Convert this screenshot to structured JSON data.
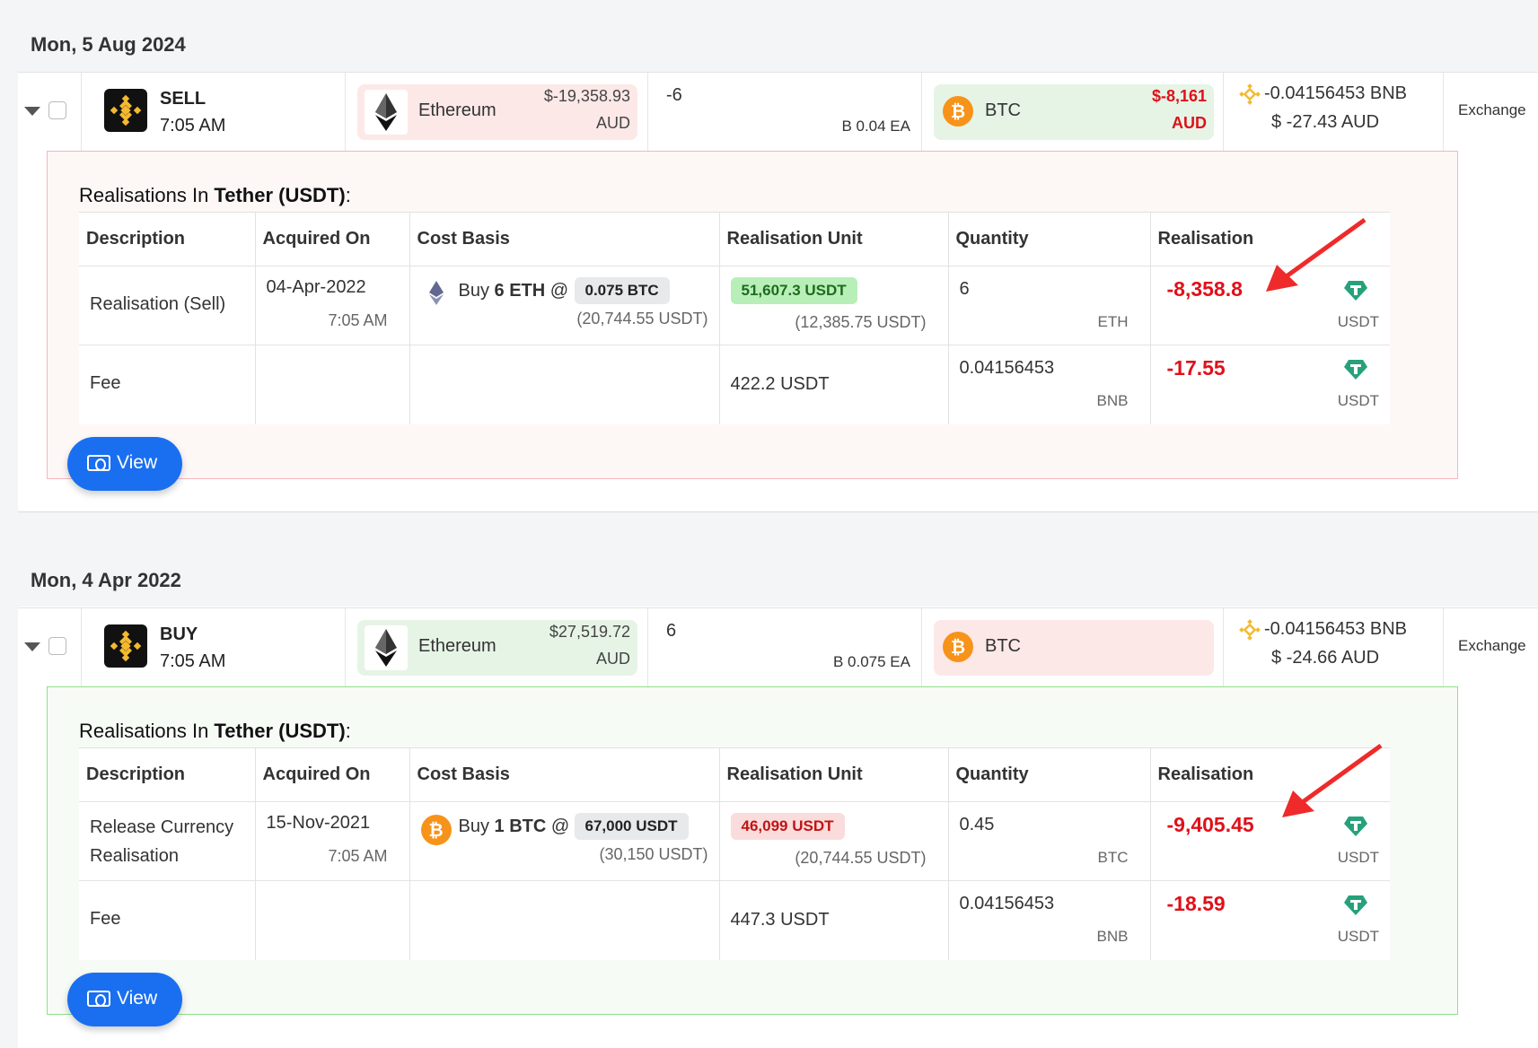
{
  "groups": [
    {
      "date": "Mon, 5 Aug 2024",
      "tx": {
        "side": "SELL",
        "time": "7:05 AM",
        "asset": {
          "name": "Ethereum",
          "amount": "$-19,358.93",
          "currency": "AUD"
        },
        "quantity": "-6",
        "price": "B 0.04 EA",
        "counter": {
          "name": "BTC",
          "amount": "$-8,161",
          "currency": "AUD"
        },
        "fee": {
          "amount": "-0.04156453 BNB",
          "value": "$ -27.43 AUD"
        },
        "type": "Exchange"
      },
      "panel": {
        "title_prefix": "Realisations In ",
        "title_bold": "Tether (USDT)",
        "title_suffix": ":",
        "rows": [
          {
            "description": "Realisation (Sell)",
            "acquired_date": "04-Apr-2022",
            "acquired_time": "7:05 AM",
            "cost_prefix": "Buy ",
            "cost_bold": "6 ETH",
            "cost_at": " @",
            "cost_badge": "0.075 BTC",
            "cost_sub": "(20,744.55 USDT)",
            "unit_badge": "51,607.3 USDT",
            "unit_sub": "(12,385.75 USDT)",
            "quantity": "6",
            "quantity_unit": "ETH",
            "realisation": "-8,358.8",
            "realisation_unit": "USDT"
          },
          {
            "description": "Fee",
            "unit_plain": "422.2 USDT",
            "quantity": "0.04156453",
            "quantity_unit": "BNB",
            "realisation": "-17.55",
            "realisation_unit": "USDT"
          }
        ],
        "view_label": "View"
      }
    },
    {
      "date": "Mon, 4 Apr 2022",
      "tx": {
        "side": "BUY",
        "time": "7:05 AM",
        "asset": {
          "name": "Ethereum",
          "amount": "$27,519.72",
          "currency": "AUD"
        },
        "quantity": "6",
        "price": "B 0.075 EA",
        "counter": {
          "name": "BTC"
        },
        "fee": {
          "amount": "-0.04156453 BNB",
          "value": "$ -24.66 AUD"
        },
        "type": "Exchange"
      },
      "panel": {
        "title_prefix": "Realisations In ",
        "title_bold": "Tether (USDT)",
        "title_suffix": ":",
        "rows": [
          {
            "description_line1": "Release Currency",
            "description_line2": "Realisation",
            "acquired_date": "15-Nov-2021",
            "acquired_time": "7:05 AM",
            "cost_prefix": "Buy ",
            "cost_bold": "1 BTC",
            "cost_at": " @",
            "cost_badge": "67,000 USDT",
            "cost_sub": "(30,150 USDT)",
            "unit_badge": "46,099 USDT",
            "unit_sub": "(20,744.55 USDT)",
            "quantity": "0.45",
            "quantity_unit": "BTC",
            "realisation": "-9,405.45",
            "realisation_unit": "USDT"
          },
          {
            "description": "Fee",
            "unit_plain": "447.3 USDT",
            "quantity": "0.04156453",
            "quantity_unit": "BNB",
            "realisation": "-18.59",
            "realisation_unit": "USDT"
          }
        ],
        "view_label": "View"
      }
    }
  ],
  "table_headers": [
    "Description",
    "Acquired On",
    "Cost Basis",
    "Realisation Unit",
    "Quantity",
    "Realisation"
  ],
  "colors": {
    "sell_panel_border": "#f5b6bd",
    "buy_panel_border": "#8fe08a",
    "negative": "#e0101a",
    "primary_button": "#1a6ff0",
    "annotation_arrow": "#ee2a2a"
  }
}
